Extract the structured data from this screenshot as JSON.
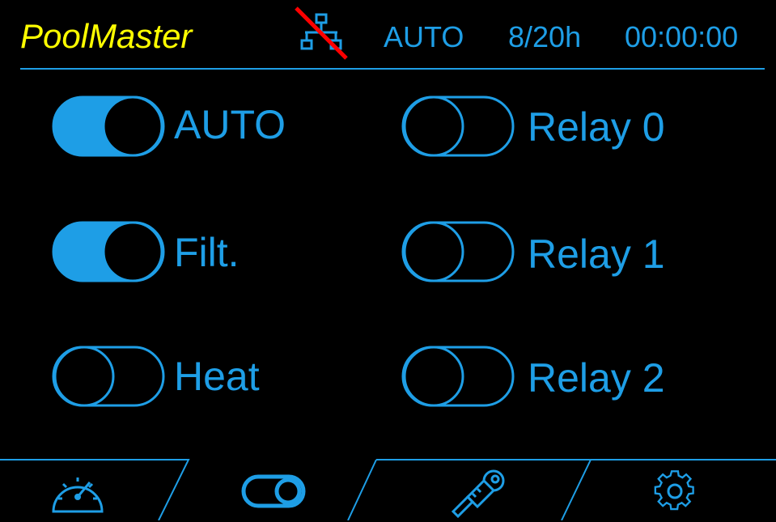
{
  "header": {
    "title": "PoolMaster",
    "mode": "AUTO",
    "filtration_hours": "8/20h",
    "clock": "00:00:00",
    "network_status_icon": "network-disconnected-icon"
  },
  "toggles": [
    {
      "label": "AUTO",
      "on": true
    },
    {
      "label": "Filt.",
      "on": true
    },
    {
      "label": "Heat",
      "on": false
    },
    {
      "label": "Relay 0",
      "on": false
    },
    {
      "label": "Relay 1",
      "on": false
    },
    {
      "label": "Relay 2",
      "on": false
    }
  ],
  "navbar": {
    "tabs": [
      {
        "icon": "speedometer-icon",
        "active": false
      },
      {
        "icon": "toggle-icon",
        "active": true
      },
      {
        "icon": "probe-icon",
        "active": false
      },
      {
        "icon": "gear-icon",
        "active": false
      }
    ]
  },
  "colors": {
    "accent": "#1e9ee6",
    "title": "#ffff00",
    "background": "#000000",
    "alert": "#ff0000"
  }
}
